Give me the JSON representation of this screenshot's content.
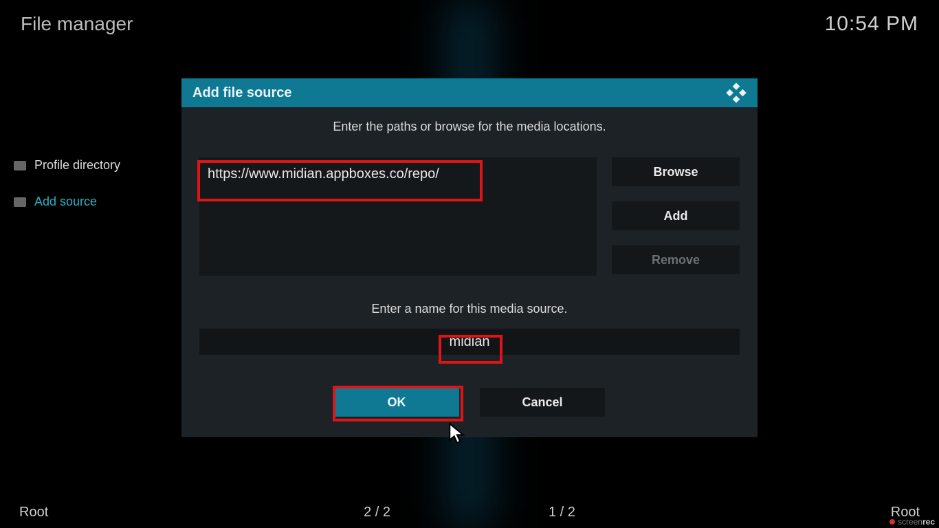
{
  "header": {
    "title": "File manager",
    "time": "10:54 PM"
  },
  "sidebar": {
    "items": [
      {
        "label": "Profile directory",
        "active": false
      },
      {
        "label": "Add source",
        "active": true
      }
    ]
  },
  "dialog": {
    "title": "Add file source",
    "instruction_paths": "Enter the paths or browse for the media locations.",
    "path_value": "https://www.midian.appboxes.co/repo/",
    "browse_label": "Browse",
    "add_label": "Add",
    "remove_label": "Remove",
    "instruction_name": "Enter a name for this media source.",
    "name_value": "midian",
    "ok_label": "OK",
    "cancel_label": "Cancel"
  },
  "footer": {
    "left": "Root",
    "center_left": "2 / 2",
    "center_right": "1 / 2",
    "right": "Root"
  },
  "watermark": {
    "part1": "screen",
    "part2": "rec"
  }
}
